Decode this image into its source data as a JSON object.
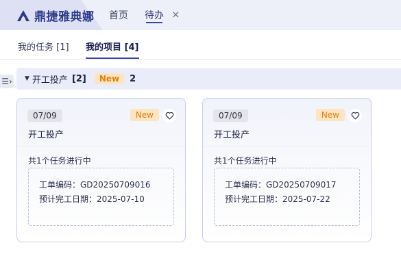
{
  "app": {
    "brand": "鼎捷雅典娜"
  },
  "nav": {
    "home": "首页",
    "todo": "待办",
    "close": "×"
  },
  "tabs": [
    {
      "label": "我的任务 [1]"
    },
    {
      "label": "我的项目 [4]"
    }
  ],
  "side_toggle": "☰›",
  "group": {
    "caret": "▼",
    "title": "开工投产",
    "count": "[2]",
    "badge": "New",
    "number": "2"
  },
  "cards": [
    {
      "date": "07/09",
      "badge": "New",
      "title": "开工投产",
      "summary": "共1个任务进行中",
      "order_no": "工单编码：GD20250709016",
      "due": "预计完工日期：2025-07-10"
    },
    {
      "date": "07/09",
      "badge": "New",
      "title": "开工投产",
      "summary": "共1个任务进行中",
      "order_no": "工单编码：GD20250709017",
      "due": "预计完工日期：2025-07-22"
    }
  ],
  "colors": {
    "brand": "#2d3a8c",
    "accent": "#3b46a8",
    "new_badge_bg": "#fde5c2",
    "new_badge_text": "#e07f12"
  },
  "icons": {
    "logo": "athena-logo-icon",
    "favorite": "heart-icon",
    "close": "close-icon",
    "collapse": "caret-down-icon"
  }
}
